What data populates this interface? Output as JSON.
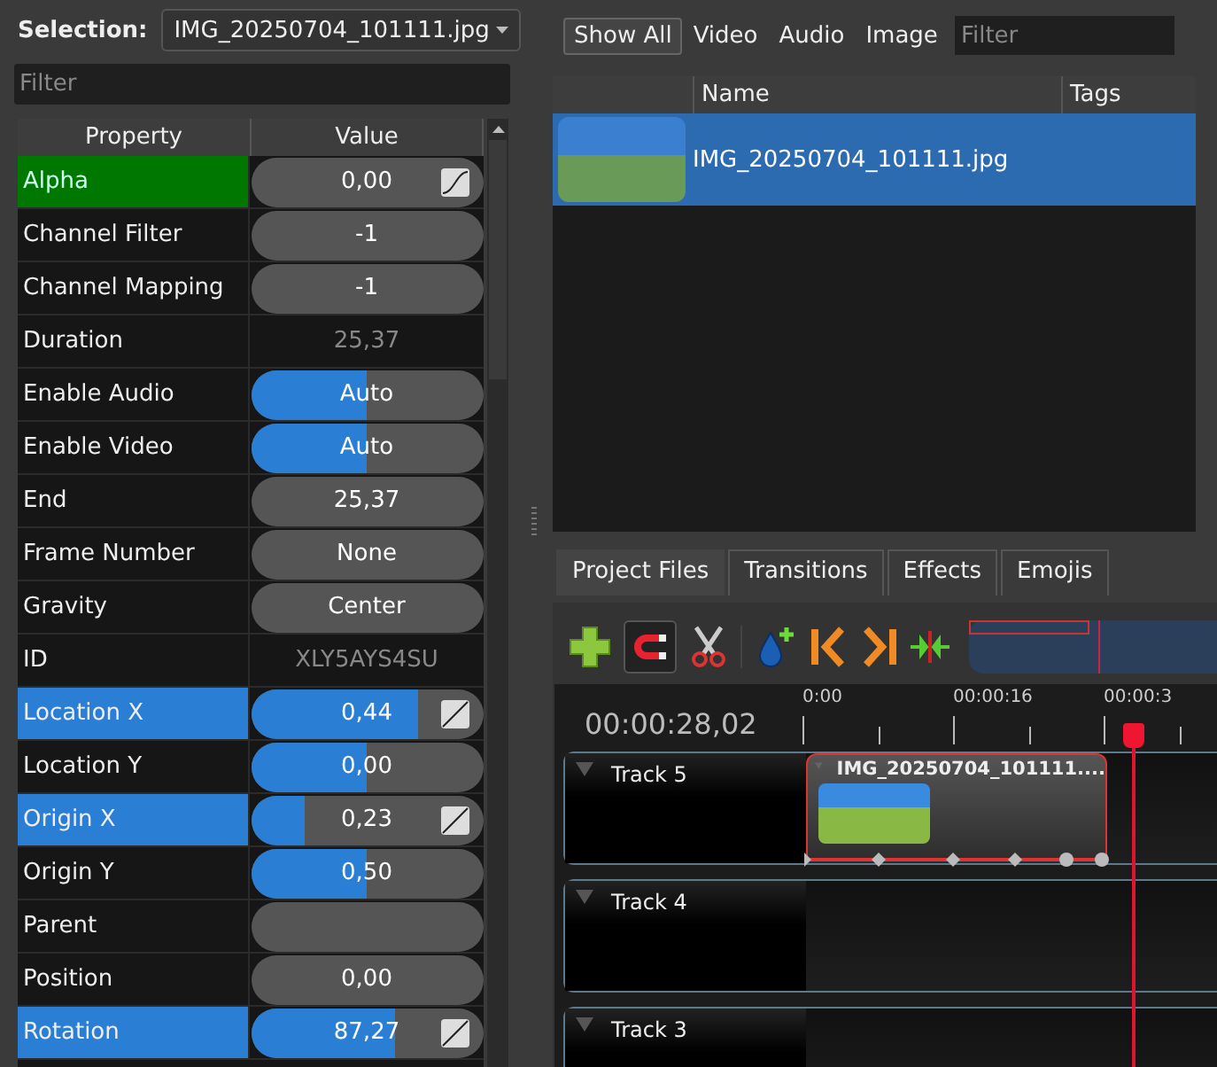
{
  "selection": {
    "label": "Selection:",
    "value": "IMG_20250704_101111.jpg"
  },
  "property_filter": {
    "placeholder": "Filter"
  },
  "properties": {
    "columns": [
      "Property",
      "Value"
    ],
    "rows": [
      {
        "name": "Alpha",
        "value": "0,00",
        "kind": "field",
        "at_keyframe": true,
        "animated": false,
        "curve_icon": true,
        "bezier": true
      },
      {
        "name": "Channel Filter",
        "value": "-1",
        "kind": "field"
      },
      {
        "name": "Channel Mapping",
        "value": "-1",
        "kind": "field"
      },
      {
        "name": "Duration",
        "value": "25,37",
        "kind": "readonly"
      },
      {
        "name": "Enable Audio",
        "value": "Auto",
        "kind": "slider",
        "level": 0.5
      },
      {
        "name": "Enable Video",
        "value": "Auto",
        "kind": "slider",
        "level": 0.5
      },
      {
        "name": "End",
        "value": "25,37",
        "kind": "field"
      },
      {
        "name": "Frame Number",
        "value": "None",
        "kind": "field"
      },
      {
        "name": "Gravity",
        "value": "Center",
        "kind": "field"
      },
      {
        "name": "ID",
        "value": "XLY5AYS4SU",
        "kind": "readonly"
      },
      {
        "name": "Location X",
        "value": "0,44",
        "kind": "slider",
        "at_keyframe": false,
        "animated": true,
        "level": 0.72,
        "curve_icon": true,
        "bezier": false
      },
      {
        "name": "Location Y",
        "value": "0,00",
        "kind": "slider",
        "level": 0.5
      },
      {
        "name": "Origin X",
        "value": "0,23",
        "kind": "slider",
        "at_keyframe": false,
        "animated": true,
        "level": 0.23,
        "curve_icon": true,
        "bezier": false
      },
      {
        "name": "Origin Y",
        "value": "0,50",
        "kind": "slider",
        "level": 0.5
      },
      {
        "name": "Parent",
        "kind": "field"
      },
      {
        "name": "Position",
        "value": "0,00",
        "kind": "field"
      },
      {
        "name": "Rotation",
        "value": "87,27",
        "kind": "slider",
        "at_keyframe": false,
        "animated": true,
        "level": 0.62,
        "curve_icon": true,
        "bezier": false
      }
    ]
  },
  "file_filters": [
    {
      "label": "Show All",
      "selected": true
    },
    {
      "label": "Video",
      "selected": false
    },
    {
      "label": "Audio",
      "selected": false
    },
    {
      "label": "Image",
      "selected": false
    }
  ],
  "file_search": {
    "placeholder": "Filter"
  },
  "files": {
    "columns": [
      "Name",
      "Tags"
    ],
    "rows": [
      {
        "name": "IMG_20250704_101111.jpg",
        "selected": true
      }
    ]
  },
  "tabs": [
    {
      "label": "Project Files",
      "selected": true
    },
    {
      "label": "Transitions",
      "selected": false
    },
    {
      "label": "Effects",
      "selected": false
    },
    {
      "label": "Emojis",
      "selected": false
    }
  ],
  "toolbar": {
    "snapping_on": true
  },
  "timeline": {
    "time": "00:00:28,02",
    "ruler": [
      "0:00",
      "00:00:16",
      "00:00:3"
    ],
    "tracks": [
      {
        "name": "Track 5",
        "clips": [
          {
            "title": "IMG_20250704_101111....",
            "selected": true
          }
        ]
      },
      {
        "name": "Track 4"
      },
      {
        "name": "Track 3"
      }
    ]
  }
}
